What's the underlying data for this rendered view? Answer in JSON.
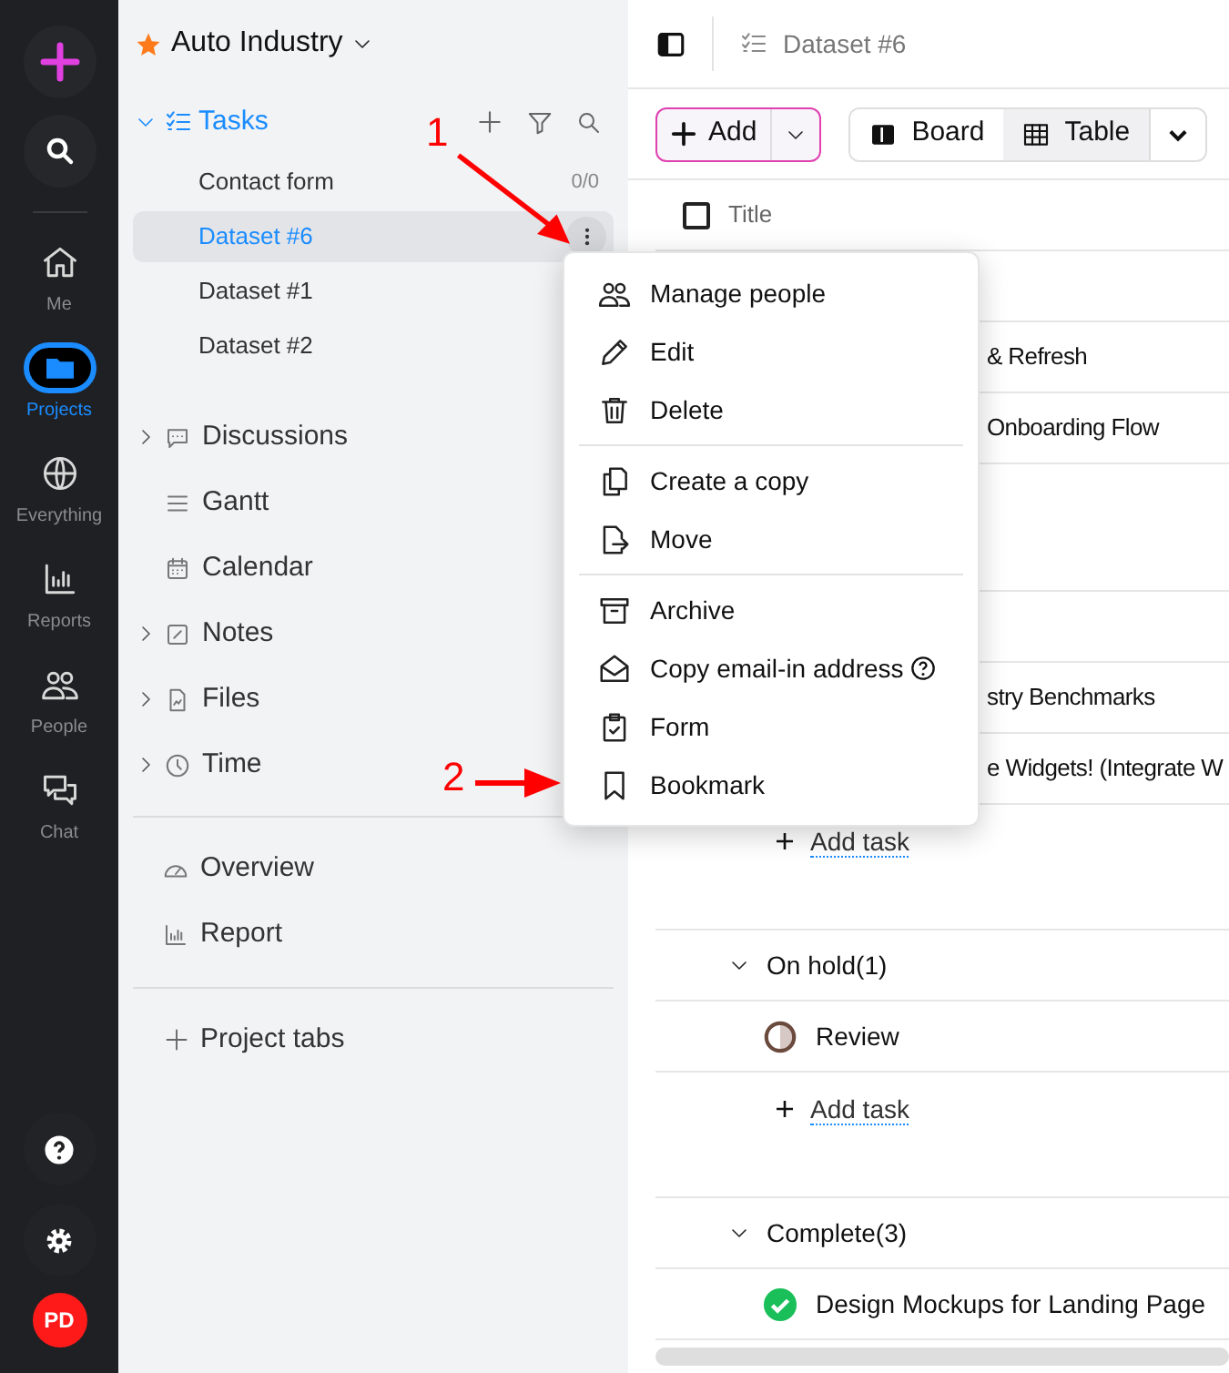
{
  "rail": {
    "items": [
      {
        "label": "Me",
        "selected": false
      },
      {
        "label": "Projects",
        "selected": true
      },
      {
        "label": "Everything",
        "selected": false
      },
      {
        "label": "Reports",
        "selected": false
      },
      {
        "label": "People",
        "selected": false
      },
      {
        "label": "Chat",
        "selected": false
      }
    ],
    "avatar": "PD"
  },
  "project": {
    "title": "Auto Industry"
  },
  "tasks": {
    "label": "Tasks",
    "expanded": true,
    "lists": [
      {
        "label": "Contact form",
        "count": "0/0",
        "selected": false
      },
      {
        "label": "Dataset #6",
        "selected": true
      },
      {
        "label": "Dataset #1",
        "selected": false
      },
      {
        "label": "Dataset #2",
        "selected": false
      }
    ]
  },
  "sections": [
    {
      "label": "Discussions",
      "expandable": true
    },
    {
      "label": "Gantt",
      "expandable": false
    },
    {
      "label": "Calendar",
      "expandable": false
    },
    {
      "label": "Notes",
      "expandable": true
    },
    {
      "label": "Files",
      "expandable": true
    },
    {
      "label": "Time",
      "expandable": true
    }
  ],
  "views": [
    {
      "label": "Overview"
    },
    {
      "label": "Report"
    }
  ],
  "project_tabs": "Project tabs",
  "header": {
    "title": "Dataset #6"
  },
  "toolbar": {
    "add": "Add",
    "views": [
      {
        "label": "Board",
        "selected": false
      },
      {
        "label": "Table",
        "selected": true
      }
    ]
  },
  "table": {
    "column": "Title",
    "select_all_checked": false,
    "rows": [
      {
        "kind": "covered"
      },
      {
        "kind": "clipped",
        "title": "& Refresh"
      },
      {
        "kind": "clipped",
        "title": "Onboarding Flow"
      },
      {
        "kind": "covered_add"
      },
      {
        "kind": "covered"
      },
      {
        "kind": "clipped",
        "title": "stry Benchmarks"
      },
      {
        "kind": "clipped",
        "title": "e Widgets! (Integrate W"
      },
      {
        "kind": "add",
        "label": "Add task"
      },
      {
        "kind": "group",
        "label": "On hold(1)",
        "expanded": true
      },
      {
        "kind": "task",
        "title": "Review",
        "complete": false
      },
      {
        "kind": "add",
        "label": "Add task"
      },
      {
        "kind": "group",
        "label": "Complete(3)",
        "expanded": true
      },
      {
        "kind": "task",
        "title": "Design Mockups for Landing Page",
        "complete": true
      }
    ]
  },
  "menu": {
    "groups": [
      [
        {
          "label": "Manage people",
          "help": false
        },
        {
          "label": "Edit",
          "help": false
        },
        {
          "label": "Delete",
          "help": false
        }
      ],
      [
        {
          "label": "Create a copy",
          "help": false
        },
        {
          "label": "Move",
          "help": false
        }
      ],
      [
        {
          "label": "Archive",
          "help": false
        },
        {
          "label": "Copy email-in address",
          "help": true
        },
        {
          "label": "Form",
          "help": false
        },
        {
          "label": "Bookmark",
          "help": false
        }
      ]
    ]
  },
  "annotations": [
    {
      "label": "1"
    },
    {
      "label": "2"
    }
  ]
}
